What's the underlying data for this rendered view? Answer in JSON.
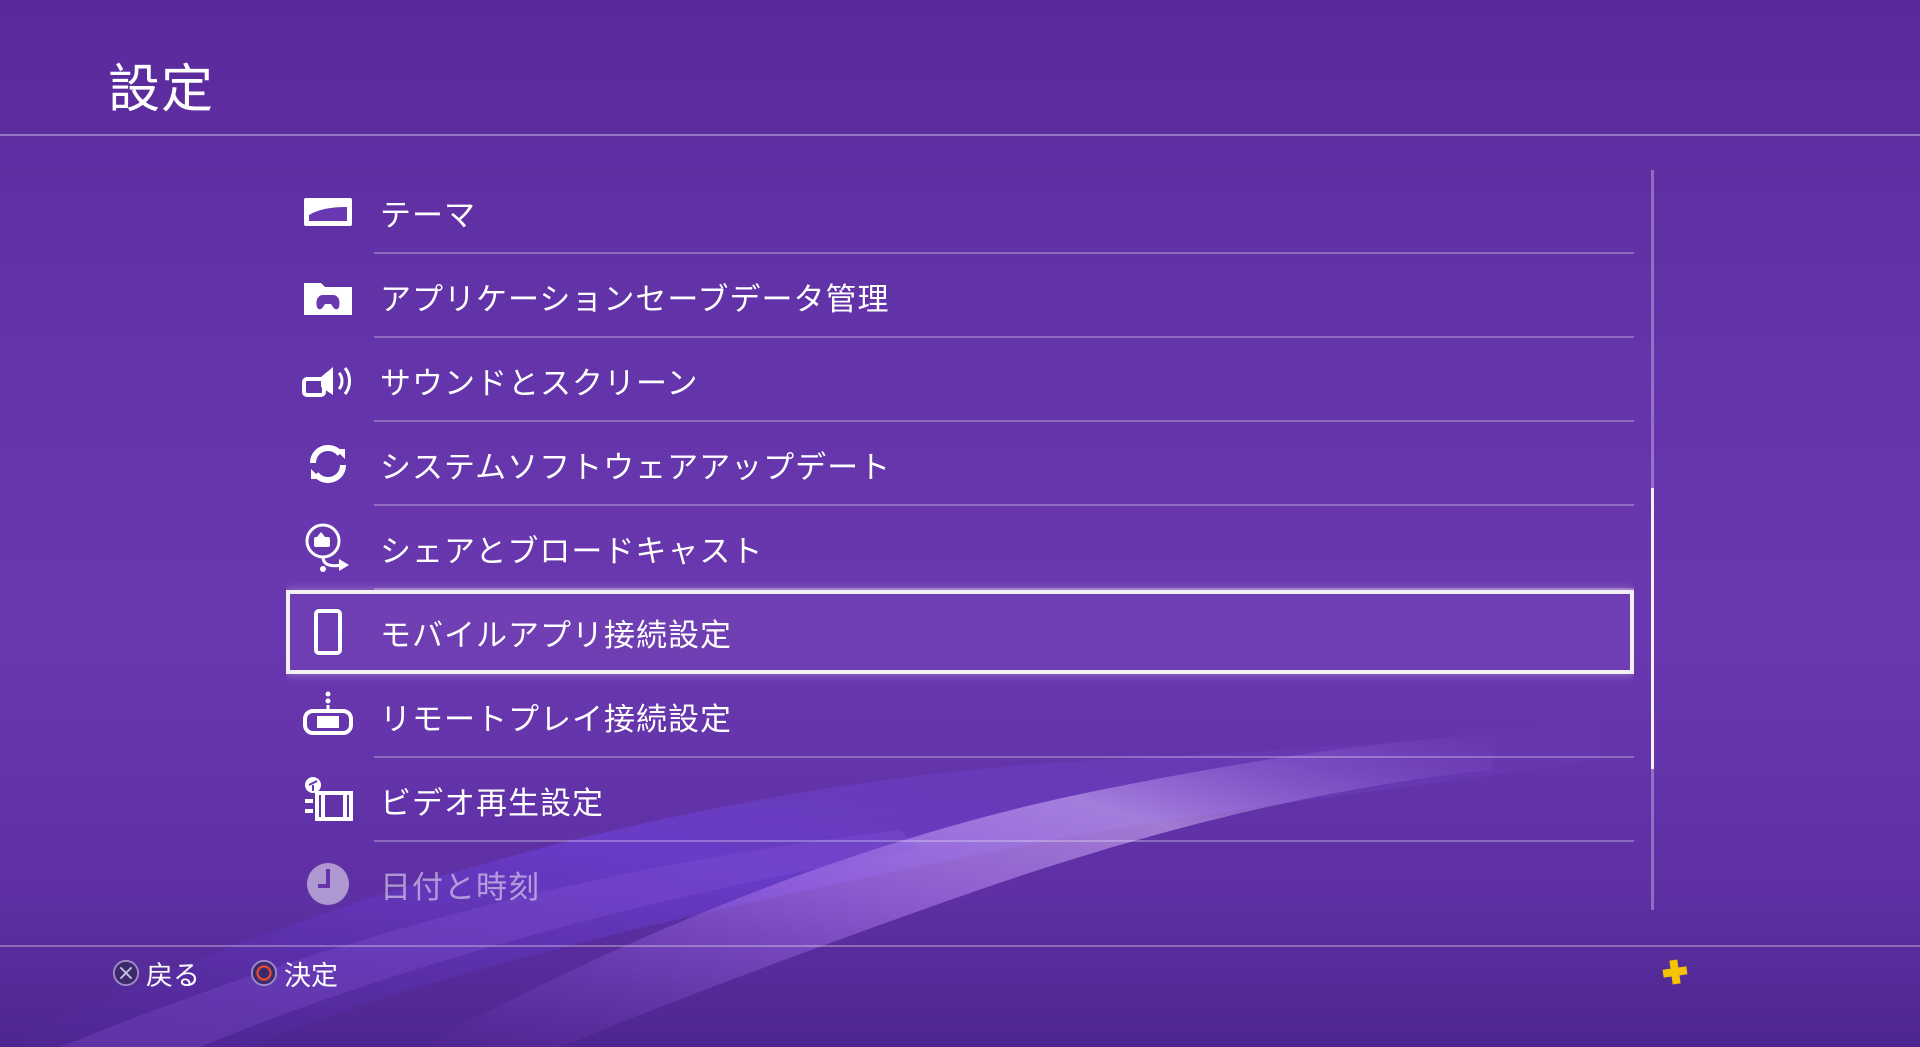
{
  "header": {
    "title": "設定"
  },
  "menu": {
    "items": [
      {
        "label": "テーマ",
        "icon": "theme-icon"
      },
      {
        "label": "アプリケーションセーブデータ管理",
        "icon": "saved-data-icon"
      },
      {
        "label": "サウンドとスクリーン",
        "icon": "sound-screen-icon"
      },
      {
        "label": "システムソフトウェアアップデート",
        "icon": "system-update-icon"
      },
      {
        "label": "シェアとブロードキャスト",
        "icon": "share-broadcast-icon"
      },
      {
        "label": "モバイルアプリ接続設定",
        "icon": "mobile-app-icon",
        "selected": true
      },
      {
        "label": "リモートプレイ接続設定",
        "icon": "remote-play-icon"
      },
      {
        "label": "ビデオ再生設定",
        "icon": "video-playback-icon"
      },
      {
        "label": "日付と時刻",
        "icon": "clock-icon"
      }
    ]
  },
  "scrollbar": {
    "position_fraction": 0.43,
    "visible_fraction": 0.38
  },
  "footer": {
    "back": {
      "label": "戻る",
      "icon": "cross-button-icon"
    },
    "confirm": {
      "label": "決定",
      "icon": "circle-button-icon"
    },
    "plus": {
      "icon": "ps-plus-icon",
      "color": "#f5c400"
    }
  },
  "colors": {
    "background": "#6434aa",
    "circle_button": "#e0483a",
    "plus": "#f5c400"
  }
}
